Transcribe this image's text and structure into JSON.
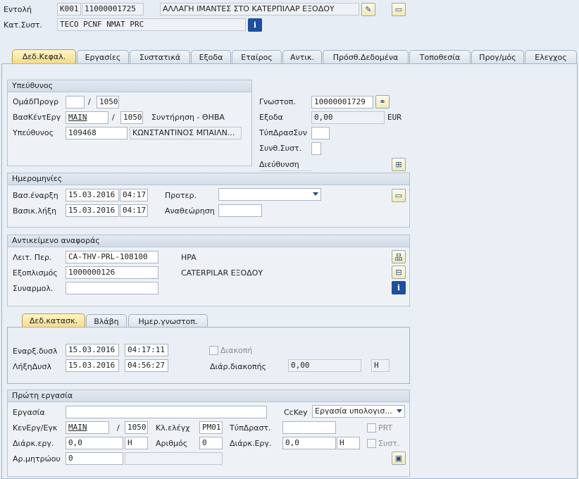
{
  "header": {
    "order_label": "Εντολή",
    "order_type": "K001",
    "order_number": "11000001725",
    "order_description": "ΑΛΛΑΓΗ ΙΜΑΝΤΕΣ ΣΤΟ ΚΑΤΕΡΠΙΛΑΡ ΕΞΟΔΟΥ",
    "status_label": "Κατ.Συστ.",
    "status_value": "TECO PCNF NMAT PRC"
  },
  "tabs": [
    {
      "label": "Δεδ.Κεφαλ.",
      "active": true
    },
    {
      "label": "Εργασίες"
    },
    {
      "label": "Συστατικά"
    },
    {
      "label": "Εξοδα"
    },
    {
      "label": "Εταίρος"
    },
    {
      "label": "Αντικ."
    },
    {
      "label": "Πρόσθ.Δεδομένα"
    },
    {
      "label": "Τοποθεσία"
    },
    {
      "label": "Προγ/μός"
    },
    {
      "label": "Ελεγχος"
    }
  ],
  "responsible": {
    "title": "Υπεύθυνος",
    "planner_group_label": "ΟμάδΠρογρ",
    "planner_group": "",
    "planner_plant": "1050",
    "work_center_label": "ΒασΚέντΕργ",
    "work_center": "MAIN",
    "work_center_plant": "1050",
    "work_center_desc": "Συντήρηση - ΘΗΒΑ",
    "person_label": "Υπεύθυνος",
    "person_id": "109468",
    "person_name": "ΚΩΝΣΤΑΝΤΙΝΟΣ ΜΠΑΙΛΝ..."
  },
  "right": {
    "notification_label": "Γνωστοπ.",
    "notification": "10000001729",
    "costs_label": "Εξοδα",
    "costs": "0,00",
    "currency": "EUR",
    "pm_act_type_label": "ΤύπΔρασΣυν",
    "pm_act_type": "",
    "sys_cond_label": "Συνθ.Συστ.",
    "sys_cond": "",
    "address_label": "Διεύθυνση"
  },
  "dates": {
    "title": "Ημερομηνίες",
    "basic_start_label": "Βασ.έναρξη",
    "basic_start_date": "15.03.2016",
    "basic_start_time": "04:17",
    "basic_end_label": "Βασικ.λήξη",
    "basic_end_date": "15.03.2016",
    "basic_end_time": "04:17",
    "priority_label": "Προτερ.",
    "priority": "",
    "revision_label": "Αναθεώρηση",
    "revision": ""
  },
  "reference": {
    "title": "Αντικείμενο αναφοράς",
    "func_loc_label": "Λειτ. Περ.",
    "func_loc": "CA-THV-PRL-108100",
    "func_loc_desc": "HPA",
    "equipment_label": "Εξοπλισμός",
    "equipment": "1000000126",
    "equipment_desc": "CATERPILAR ΕΞΟΔΟΥ",
    "assembly_label": "Συναρμολ.",
    "assembly": ""
  },
  "subtabs": [
    {
      "label": "Δεδ.κατασκ.",
      "active": true
    },
    {
      "label": "Βλάβη"
    },
    {
      "label": "Ημερ.γνωστοπ."
    }
  ],
  "malfunction": {
    "start_label": "Εναρξ.δυσλ",
    "start_date": "15.03.2016",
    "start_time": "04:17:11",
    "end_label": "ΛήξηΔυσλ",
    "end_date": "15.03.2016",
    "end_time": "04:56:27",
    "breakdown_label": "Διακοπή",
    "duration_label": "Διάρ.διακοπής",
    "duration": "0,00",
    "duration_unit": "H"
  },
  "first_op": {
    "title": "Πρώτη εργασία",
    "operation_label": "Εργασία",
    "operation": "",
    "cckey_label": "CcKey",
    "cckey": "Εργασία υπολογισ...",
    "wc_label": "ΚενΕργ/Εγκ",
    "wc": "MAIN",
    "wc_plant": "1050",
    "control_key_label": "Κλ.ελέγχ",
    "control_key": "PM01",
    "act_type_label": "ΤύπΔραστ.",
    "act_type": "",
    "prt_label": "PRT",
    "work_label": "Διάρκ.εργ.",
    "work": "0,0",
    "work_unit": "H",
    "number_label": "Αριθμός",
    "number": "0",
    "duration_label": "Διάρκ.Εργ.",
    "duration": "0,0",
    "duration_unit": "H",
    "sys_label": "Συστ.",
    "personnel_label": "Αρ.μητρώου",
    "personnel": "0",
    "personnel_name": ""
  }
}
